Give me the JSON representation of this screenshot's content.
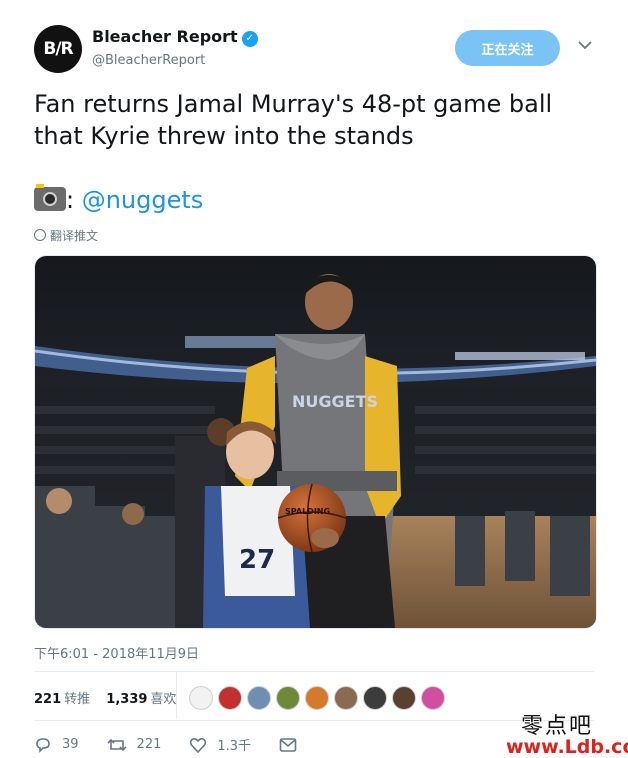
{
  "account": {
    "avatar_text": "B/R",
    "name": "Bleacher Report",
    "handle": "@BleacherReport",
    "follow_label": "正在关注"
  },
  "tweet": {
    "text": "Fan returns Jamal Murray's 48-pt game ball that Kyrie threw into the stands",
    "camera_colon": ": ",
    "mention": "@nuggets",
    "translate_label": "翻译推文",
    "timestamp": "下午6:01 - 2018年11月9日"
  },
  "photo": {
    "jersey_text": "NUGGETS",
    "kid_number": "27",
    "ball_text": "SPALDING"
  },
  "stats": {
    "retweets_count": "221",
    "retweets_label": "转推",
    "likes_count": "1,339",
    "likes_label": "喜欢"
  },
  "actions": {
    "reply_count": "39",
    "retweet_count": "221",
    "like_count": "1.3千"
  },
  "watermark": {
    "line1": "零点吧",
    "line2": "www.Ldb.cc"
  },
  "colors": {
    "accent": "#1da1f2",
    "follow_button": "#7cc3f5",
    "mention": "#1b95e0",
    "muted": "#657786"
  }
}
